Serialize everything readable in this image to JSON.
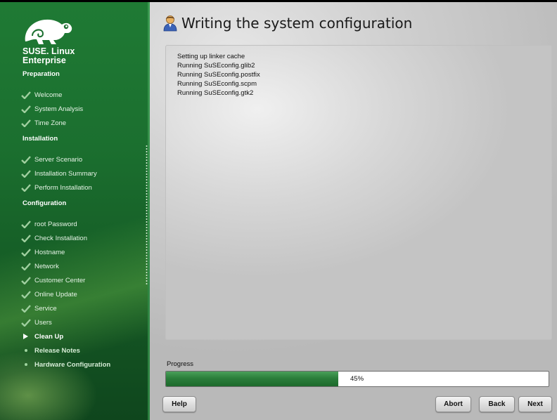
{
  "sidebar": {
    "brand_line1": "SUSE. Linux",
    "brand_line2": "Enterprise",
    "sections": [
      {
        "title": "Preparation",
        "steps": [
          {
            "label": "Welcome",
            "state": "done"
          },
          {
            "label": "System Analysis",
            "state": "done"
          },
          {
            "label": "Time Zone",
            "state": "done"
          }
        ]
      },
      {
        "title": "Installation",
        "steps": [
          {
            "label": "Server Scenario",
            "state": "done"
          },
          {
            "label": "Installation Summary",
            "state": "done"
          },
          {
            "label": "Perform Installation",
            "state": "done"
          }
        ]
      },
      {
        "title": "Configuration",
        "steps": [
          {
            "label": "root Password",
            "state": "done"
          },
          {
            "label": "Check Installation",
            "state": "done"
          },
          {
            "label": "Hostname",
            "state": "done"
          },
          {
            "label": "Network",
            "state": "done"
          },
          {
            "label": "Customer Center",
            "state": "done"
          },
          {
            "label": "Online Update",
            "state": "done"
          },
          {
            "label": "Service",
            "state": "done"
          },
          {
            "label": "Users",
            "state": "done"
          },
          {
            "label": "Clean Up",
            "state": "current"
          },
          {
            "label": "Release Notes",
            "state": "todo"
          },
          {
            "label": "Hardware Configuration",
            "state": "todo"
          }
        ]
      }
    ]
  },
  "main": {
    "title": "Writing the system configuration",
    "title_icon": "user-admin-icon",
    "log": [
      "Setting up linker cache",
      "Running SuSEconfig.glib2",
      "Running SuSEconfig.postfix",
      "Running SuSEconfig.scpm",
      "Running SuSEconfig.gtk2"
    ],
    "progress": {
      "label": "Progress",
      "value": 45,
      "text": "45%"
    }
  },
  "buttons": {
    "help": "Help",
    "abort": "Abort",
    "back": "Back",
    "next": "Next"
  },
  "colors": {
    "sidebar_green": "#1b6f2f",
    "progress_green": "#2b7e3b"
  }
}
